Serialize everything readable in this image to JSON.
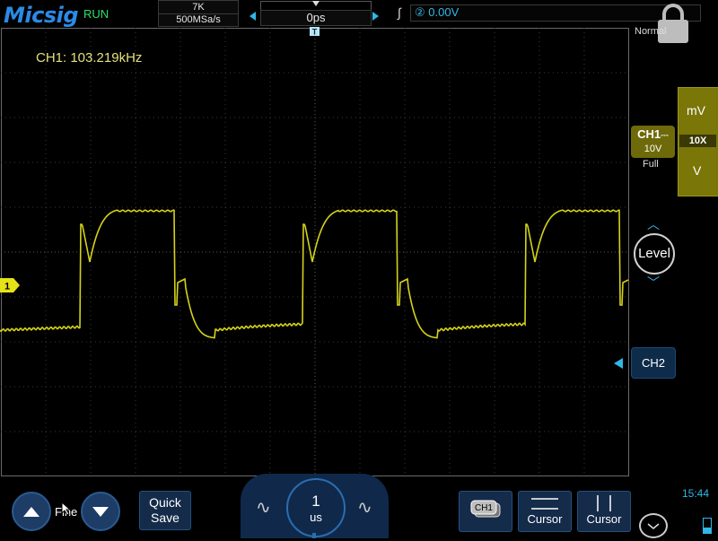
{
  "header": {
    "brand": "Micsig",
    "status": "RUN",
    "memory_depth": "7K",
    "sample_rate": "500MSa/s",
    "horizontal_position": "0ps",
    "trigger_source_icon": "②",
    "trigger_level": "0.00V",
    "trigger_mode": "Normal"
  },
  "measurement": {
    "label": "CH1: 103.219kHz"
  },
  "channel1": {
    "name": "CH1",
    "coupling_icon": "⎓",
    "volts_per_div": "10V",
    "bandwidth": "Full",
    "marker": "1",
    "color": "#d4d21a"
  },
  "scale_panel": {
    "mv": "mV",
    "probe": "10X",
    "v": "V"
  },
  "level_control": {
    "label": "Level",
    "up": "︿",
    "down": "﹀"
  },
  "channel2": {
    "name": "CH2",
    "color": "#2fb8e6"
  },
  "bottom": {
    "fine_label": "Fine",
    "save_label": "Quick\nSave",
    "timebase_value": "1",
    "timebase_unit": "us",
    "wave_left": "∿",
    "wave_right": "∿",
    "channel_select": "CH1",
    "cursor1": "Cursor",
    "cursor2": "Cursor",
    "clock": "15:44"
  }
}
